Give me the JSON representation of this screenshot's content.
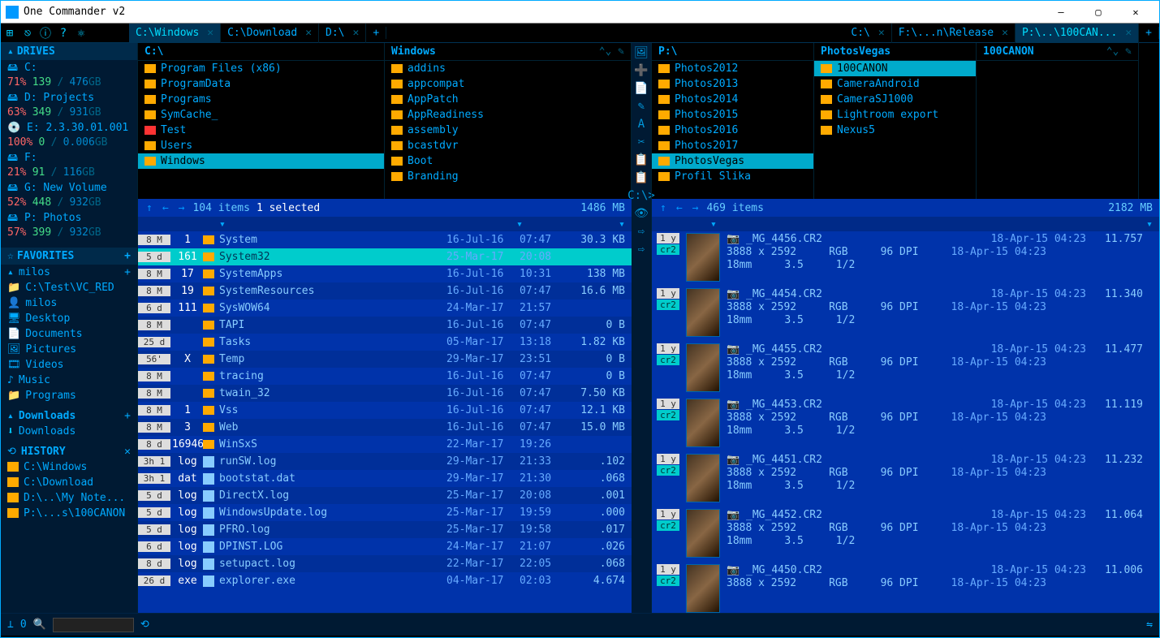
{
  "title": "One Commander v2",
  "toolbar_icons": [
    "⊞",
    "⎋",
    "ⓘ",
    "?",
    "⚛"
  ],
  "left_tabs": [
    {
      "label": "C:\\Windows",
      "active": true
    },
    {
      "label": "C:\\Download",
      "active": false
    },
    {
      "label": "D:\\",
      "active": false
    }
  ],
  "right_tabs": [
    {
      "label": "C:\\",
      "active": false
    },
    {
      "label": "F:\\...n\\Release",
      "active": false
    },
    {
      "label": "P:\\..\\100CAN...",
      "active": true
    }
  ],
  "sidebar": {
    "drives_hdr": "DRIVES",
    "drives": [
      {
        "icon": "🖴",
        "name": "C:",
        "pct": "71%",
        "used": "139",
        "tot": "476",
        "unit": "GB"
      },
      {
        "icon": "🖴",
        "name": "D: Projects",
        "pct": "63%",
        "used": "349",
        "tot": "931",
        "unit": "GB"
      },
      {
        "icon": "💿",
        "name": "E: 2.3.30.01.001",
        "pct": "100%",
        "used": "0",
        "tot": "0.006",
        "unit": "GB"
      },
      {
        "icon": "🖴",
        "name": "F:",
        "pct": "21%",
        "used": "91",
        "tot": "116",
        "unit": "GB"
      },
      {
        "icon": "🖴",
        "name": "G: New Volume",
        "pct": "52%",
        "used": "448",
        "tot": "932",
        "unit": "GB"
      },
      {
        "icon": "🖴",
        "name": "P: Photos",
        "pct": "57%",
        "used": "399",
        "tot": "932",
        "unit": "GB"
      }
    ],
    "fav_hdr": "FAVORITES",
    "fav_user": "milos",
    "favs": [
      {
        "icon": "📁",
        "label": "C:\\Test\\VC_RED"
      },
      {
        "icon": "👤",
        "label": "milos"
      },
      {
        "icon": "🖥",
        "label": "Desktop"
      },
      {
        "icon": "📄",
        "label": "Documents"
      },
      {
        "icon": "🖼",
        "label": "Pictures"
      },
      {
        "icon": "🎞",
        "label": "Videos"
      },
      {
        "icon": "♪",
        "label": "Music"
      },
      {
        "icon": "📁",
        "label": "Programs"
      }
    ],
    "dl_hdr": "Downloads",
    "dl_item": "Downloads",
    "hist_hdr": "HISTORY",
    "hist": [
      "C:\\Windows",
      "C:\\Download",
      "D:\\..\\My Note...",
      "P:\\...s\\100CANON"
    ]
  },
  "left_pane": {
    "crumb_cols": [
      {
        "hdr": "C:\\",
        "items": [
          {
            "t": "Program Files (x86)"
          },
          {
            "t": "ProgramData"
          },
          {
            "t": "Programs"
          },
          {
            "t": "SymCache_"
          },
          {
            "t": "Test",
            "red": true
          },
          {
            "t": "Users"
          },
          {
            "t": "Windows",
            "sel": true
          }
        ]
      },
      {
        "hdr": "Windows",
        "nav": true,
        "items": [
          {
            "t": "addins"
          },
          {
            "t": "appcompat"
          },
          {
            "t": "AppPatch"
          },
          {
            "t": "AppReadiness"
          },
          {
            "t": "assembly"
          },
          {
            "t": "bcastdvr"
          },
          {
            "t": "Boot"
          },
          {
            "t": "Branding"
          }
        ]
      }
    ],
    "status": {
      "items": "104 items",
      "sel": "1 selected",
      "size": "1486 MB"
    },
    "rows": [
      {
        "age": "8 M",
        "cnt": "1",
        "f": true,
        "name": "System",
        "date": "16-Jul-16",
        "time": "07:47",
        "size": "30.3 KB"
      },
      {
        "age": "5 d",
        "cnt": "161",
        "f": true,
        "name": "System32",
        "date": "25-Mar-17",
        "time": "20:08",
        "size": "",
        "sel": true
      },
      {
        "age": "8 M",
        "cnt": "17",
        "f": true,
        "name": "SystemApps",
        "date": "16-Jul-16",
        "time": "10:31",
        "size": "138 MB"
      },
      {
        "age": "8 M",
        "cnt": "19",
        "f": true,
        "name": "SystemResources",
        "date": "16-Jul-16",
        "time": "07:47",
        "size": "16.6 MB"
      },
      {
        "age": "6 d",
        "cnt": "111",
        "f": true,
        "name": "SysWOW64",
        "date": "24-Mar-17",
        "time": "21:57",
        "size": ""
      },
      {
        "age": "8 M",
        "cnt": "",
        "f": true,
        "name": "TAPI",
        "date": "16-Jul-16",
        "time": "07:47",
        "size": "0 B"
      },
      {
        "age": "25 d",
        "cnt": "",
        "f": true,
        "name": "Tasks",
        "date": "05-Mar-17",
        "time": "13:18",
        "size": "1.82 KB"
      },
      {
        "age": "56'",
        "cnt": "X",
        "f": true,
        "name": "Temp",
        "date": "29-Mar-17",
        "time": "23:51",
        "size": "0 B"
      },
      {
        "age": "8 M",
        "cnt": "",
        "f": true,
        "name": "tracing",
        "date": "16-Jul-16",
        "time": "07:47",
        "size": "0 B"
      },
      {
        "age": "8 M",
        "cnt": "",
        "f": true,
        "name": "twain_32",
        "date": "16-Jul-16",
        "time": "07:47",
        "size": "7.50 KB"
      },
      {
        "age": "8 M",
        "cnt": "1",
        "f": true,
        "name": "Vss",
        "date": "16-Jul-16",
        "time": "07:47",
        "size": "12.1 KB"
      },
      {
        "age": "8 M",
        "cnt": "3",
        "f": true,
        "name": "Web",
        "date": "16-Jul-16",
        "time": "07:47",
        "size": "15.0 MB"
      },
      {
        "age": "8 d",
        "cnt": "16946",
        "f": true,
        "name": "WinSxS",
        "date": "22-Mar-17",
        "time": "19:26",
        "size": ""
      },
      {
        "age": "3h 1",
        "cnt": "log",
        "f": false,
        "name": "runSW.log",
        "date": "29-Mar-17",
        "time": "21:33",
        "size": ".102"
      },
      {
        "age": "3h 1",
        "cnt": "dat",
        "f": false,
        "name": "bootstat.dat",
        "date": "29-Mar-17",
        "time": "21:30",
        "size": ".068"
      },
      {
        "age": "5 d",
        "cnt": "log",
        "f": false,
        "name": "DirectX.log",
        "date": "25-Mar-17",
        "time": "20:08",
        "size": ".001"
      },
      {
        "age": "5 d",
        "cnt": "log",
        "f": false,
        "name": "WindowsUpdate.log",
        "date": "25-Mar-17",
        "time": "19:59",
        "size": ".000"
      },
      {
        "age": "5 d",
        "cnt": "log",
        "f": false,
        "name": "PFRO.log",
        "date": "25-Mar-17",
        "time": "19:58",
        "size": ".017"
      },
      {
        "age": "6 d",
        "cnt": "log",
        "f": false,
        "name": "DPINST.LOG",
        "date": "24-Mar-17",
        "time": "21:07",
        "size": ".026"
      },
      {
        "age": "8 d",
        "cnt": "log",
        "f": false,
        "name": "setupact.log",
        "date": "22-Mar-17",
        "time": "22:05",
        "size": ".068"
      },
      {
        "age": "26 d",
        "cnt": "exe",
        "f": false,
        "name": "explorer.exe",
        "date": "04-Mar-17",
        "time": "02:03",
        "size": "4.674"
      }
    ]
  },
  "right_pane": {
    "crumb_cols": [
      {
        "hdr": "P:\\",
        "items": [
          {
            "t": "Photos2012"
          },
          {
            "t": "Photos2013"
          },
          {
            "t": "Photos2014"
          },
          {
            "t": "Photos2015"
          },
          {
            "t": "Photos2016"
          },
          {
            "t": "Photos2017"
          },
          {
            "t": "PhotosVegas",
            "sel": true
          },
          {
            "t": "Profil Slika"
          }
        ]
      },
      {
        "hdr": "PhotosVegas",
        "items": [
          {
            "t": "100CANON",
            "sel": true
          },
          {
            "t": "CameraAndroid"
          },
          {
            "t": "CameraSJ1000"
          },
          {
            "t": "Lightroom export"
          },
          {
            "t": "Nexus5"
          }
        ]
      },
      {
        "hdr": "100CANON",
        "nav": true,
        "items": []
      }
    ],
    "status": {
      "items": "469 items",
      "size": "2182 MB"
    },
    "photos": [
      {
        "age": "1 y",
        "ext": "cr2",
        "name": "_MG_4456.CR2",
        "dim": "3888 x 2592",
        "cs": "RGB",
        "dpi": "96 DPI",
        "fl": "18mm",
        "ap": "3.5",
        "sh": "1/2",
        "date1": "18-Apr-15  04:23",
        "date2": "18-Apr-15  04:23",
        "size": "11.757"
      },
      {
        "age": "1 y",
        "ext": "cr2",
        "name": "_MG_4454.CR2",
        "dim": "3888 x 2592",
        "cs": "RGB",
        "dpi": "96 DPI",
        "fl": "18mm",
        "ap": "3.5",
        "sh": "1/2",
        "date1": "18-Apr-15  04:23",
        "date2": "18-Apr-15  04:23",
        "size": "11.340"
      },
      {
        "age": "1 y",
        "ext": "cr2",
        "name": "_MG_4455.CR2",
        "dim": "3888 x 2592",
        "cs": "RGB",
        "dpi": "96 DPI",
        "fl": "18mm",
        "ap": "3.5",
        "sh": "1/2",
        "date1": "18-Apr-15  04:23",
        "date2": "18-Apr-15  04:23",
        "size": "11.477"
      },
      {
        "age": "1 y",
        "ext": "cr2",
        "name": "_MG_4453.CR2",
        "dim": "3888 x 2592",
        "cs": "RGB",
        "dpi": "96 DPI",
        "fl": "18mm",
        "ap": "3.5",
        "sh": "1/2",
        "date1": "18-Apr-15  04:23",
        "date2": "18-Apr-15  04:23",
        "size": "11.119"
      },
      {
        "age": "1 y",
        "ext": "cr2",
        "name": "_MG_4451.CR2",
        "dim": "3888 x 2592",
        "cs": "RGB",
        "dpi": "96 DPI",
        "fl": "18mm",
        "ap": "3.5",
        "sh": "1/2",
        "date1": "18-Apr-15  04:23",
        "date2": "18-Apr-15  04:23",
        "size": "11.232"
      },
      {
        "age": "1 y",
        "ext": "cr2",
        "name": "_MG_4452.CR2",
        "dim": "3888 x 2592",
        "cs": "RGB",
        "dpi": "96 DPI",
        "fl": "18mm",
        "ap": "3.5",
        "sh": "1/2",
        "date1": "18-Apr-15  04:23",
        "date2": "18-Apr-15  04:23",
        "size": "11.064"
      },
      {
        "age": "1 y",
        "ext": "cr2",
        "name": "_MG_4450.CR2",
        "dim": "3888 x 2592",
        "cs": "RGB",
        "dpi": "96 DPI",
        "fl": "",
        "ap": "",
        "sh": "",
        "date1": "18-Apr-15  04:23",
        "date2": "18-Apr-15  04:23",
        "size": "11.006"
      }
    ]
  },
  "iconstrip": [
    "🖼",
    "➕",
    "📄",
    "✎",
    "A",
    "✂",
    "📋",
    "📋",
    "C:\\>",
    "👁",
    "⇨",
    "⇨"
  ],
  "bottombar": {
    "count": "0"
  }
}
